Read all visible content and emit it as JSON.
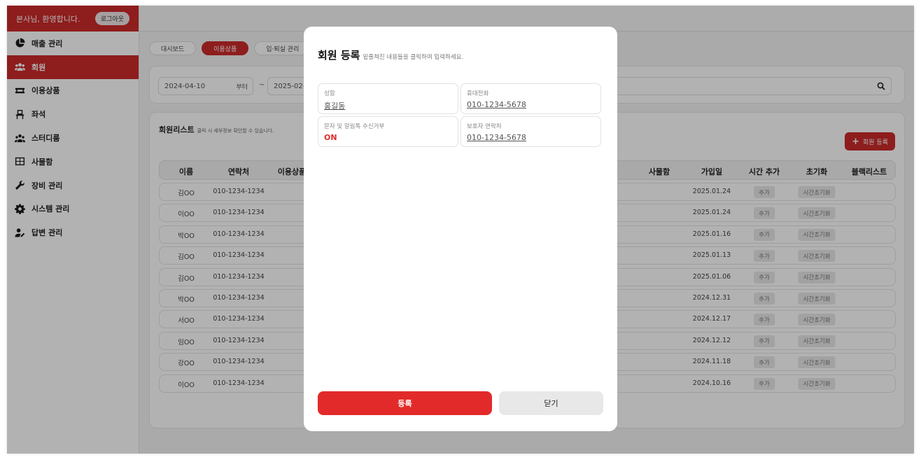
{
  "header": {
    "welcome": "본사님, 환영합니다.",
    "logout_label": "로그아웃"
  },
  "sidebar": {
    "items": [
      {
        "label": "매출 관리",
        "icon": "chart-pie-icon",
        "active": false
      },
      {
        "label": "회원",
        "icon": "users-icon",
        "active": true
      },
      {
        "label": "이용상품",
        "icon": "ticket-icon",
        "active": false
      },
      {
        "label": "좌석",
        "icon": "chair-icon",
        "active": false
      },
      {
        "label": "스터디룸",
        "icon": "group-icon",
        "active": false
      },
      {
        "label": "사물함",
        "icon": "locker-icon",
        "active": false
      },
      {
        "label": "장비 관리",
        "icon": "wrench-icon",
        "active": false
      },
      {
        "label": "시스템 관리",
        "icon": "gear-icon",
        "active": false
      },
      {
        "label": "답변 관리",
        "icon": "user-edit-icon",
        "active": false
      }
    ]
  },
  "tabs": [
    {
      "label": "대시보드",
      "active": false
    },
    {
      "label": "이용상품",
      "active": true
    },
    {
      "label": "입·퇴실 관리",
      "active": false
    }
  ],
  "filter": {
    "start_date": "2024-04-10",
    "start_suffix": "부터",
    "tilde": "~",
    "end_date": "2025-02-"
  },
  "list": {
    "title": "회원리스트",
    "subtitle": "클릭 시 세부정보 확인할 수 있습니다.",
    "add_button": "회원 등록",
    "columns": [
      "이름",
      "연락처",
      "이용상품",
      "사물함",
      "가입일",
      "시간 추가",
      "초기화",
      "블랙리스트"
    ],
    "rows": [
      {
        "name": "김OO",
        "phone": "010-1234-1234",
        "joined": "2025.01.24",
        "add_time": "추가",
        "reset": "시간초기화"
      },
      {
        "name": "이OO",
        "phone": "010-1234-1234",
        "joined": "2025.01.24",
        "add_time": "추가",
        "reset": "시간초기화"
      },
      {
        "name": "박OO",
        "phone": "010-1234-1234",
        "joined": "2025.01.16",
        "add_time": "추가",
        "reset": "시간초기화"
      },
      {
        "name": "김OO",
        "phone": "010-1234-1234",
        "joined": "2025.01.13",
        "add_time": "추가",
        "reset": "시간초기화"
      },
      {
        "name": "김OO",
        "phone": "010-1234-1234",
        "joined": "2025.01.06",
        "add_time": "추가",
        "reset": "시간초기화"
      },
      {
        "name": "박OO",
        "phone": "010-1234-1234",
        "joined": "2024.12.31",
        "add_time": "추가",
        "reset": "시간초기화"
      },
      {
        "name": "서OO",
        "phone": "010-1234-1234",
        "joined": "2024.12.17",
        "add_time": "추가",
        "reset": "시간초기화"
      },
      {
        "name": "임OO",
        "phone": "010-1234-1234",
        "joined": "2024.12.12",
        "add_time": "추가",
        "reset": "시간초기화"
      },
      {
        "name": "강OO",
        "phone": "010-1234-1234",
        "joined": "2024.11.18",
        "add_time": "추가",
        "reset": "시간초기화"
      },
      {
        "name": "이OO",
        "phone": "010-1234-1234",
        "joined": "2024.10.16",
        "add_time": "추가",
        "reset": "시간초기화"
      }
    ]
  },
  "modal": {
    "title": "회원 등록",
    "subtitle": "밑줄쳐진 내용들을 클릭하여 입력하세요.",
    "fields": {
      "name": {
        "label": "성함",
        "value": "홍길동"
      },
      "phone": {
        "label": "휴대전화",
        "value": "010-1234-5678"
      },
      "sms": {
        "label": "문자 및 알림톡 수신거부",
        "value": "ON"
      },
      "guardian": {
        "label": "보호자 연락처",
        "value": "010-1234-5678"
      }
    },
    "submit_label": "등록",
    "close_label": "닫기"
  },
  "colors": {
    "brand_red": "#cc2a2a",
    "button_red": "#e32a2a",
    "on_red": "#e22a2a"
  }
}
